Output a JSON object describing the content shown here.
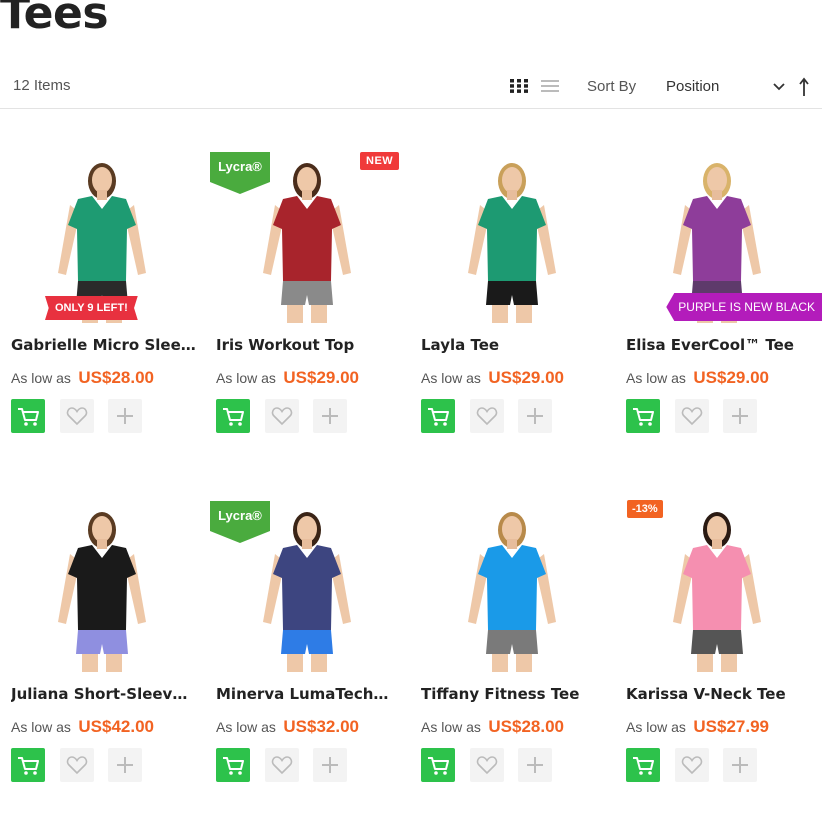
{
  "page": {
    "title": "Tees"
  },
  "toolbar": {
    "item_count": "12 Items",
    "sort_label": "Sort By",
    "sort_value": "Position",
    "view_modes": [
      "grid-icon",
      "list-icon"
    ]
  },
  "colors": {
    "price": "#f26322",
    "cart_button": "#2dc24b",
    "badge_new": "#f03a3a",
    "badge_lycra": "#4aab3e",
    "ribbon_red": "#e8313f",
    "ribbon_purple": "#b31cbb"
  },
  "products": [
    {
      "name": "Gabrielle Micro Sleeve T...",
      "price_prefix": "As low as",
      "price": "US$28.00",
      "shirt_color": "#1e9b72",
      "bottom_color": "#2a2a2a",
      "ribbon": "ONLY 9 LEFT!"
    },
    {
      "name": "Iris Workout Top",
      "price_prefix": "As low as",
      "price": "US$29.00",
      "shirt_color": "#a8242c",
      "bottom_color": "#8a8a8a",
      "badge": "NEW",
      "lycra": "Lycra®"
    },
    {
      "name": "Layla Tee",
      "price_prefix": "As low as",
      "price": "US$29.00",
      "shirt_color": "#1d9a72",
      "bottom_color": "#1a1a1a"
    },
    {
      "name": "Elisa EverCool™ Tee",
      "price_prefix": "As low as",
      "price": "US$29.00",
      "shirt_color": "#8e3d9a",
      "bottom_color": "#5e3a6b",
      "ribbon": "PURPLE IS NEW BLACK"
    },
    {
      "name": "Juliana Short-Sleeve Tee",
      "price_prefix": "As low as",
      "price": "US$42.00",
      "shirt_color": "#1a1a1a",
      "bottom_color": "#8f8fe0"
    },
    {
      "name": "Minerva LumaTech™ V-...",
      "price_prefix": "As low as",
      "price": "US$32.00",
      "shirt_color": "#3d4580",
      "bottom_color": "#2e7ce6",
      "lycra": "Lycra®"
    },
    {
      "name": "Tiffany Fitness Tee",
      "price_prefix": "As low as",
      "price": "US$28.00",
      "shirt_color": "#1a9ae8",
      "bottom_color": "#7a7a7a"
    },
    {
      "name": "Karissa V-Neck Tee",
      "price_prefix": "As low as",
      "price": "US$27.99",
      "shirt_color": "#f58fb0",
      "bottom_color": "#555555",
      "discount": "-13%"
    }
  ]
}
